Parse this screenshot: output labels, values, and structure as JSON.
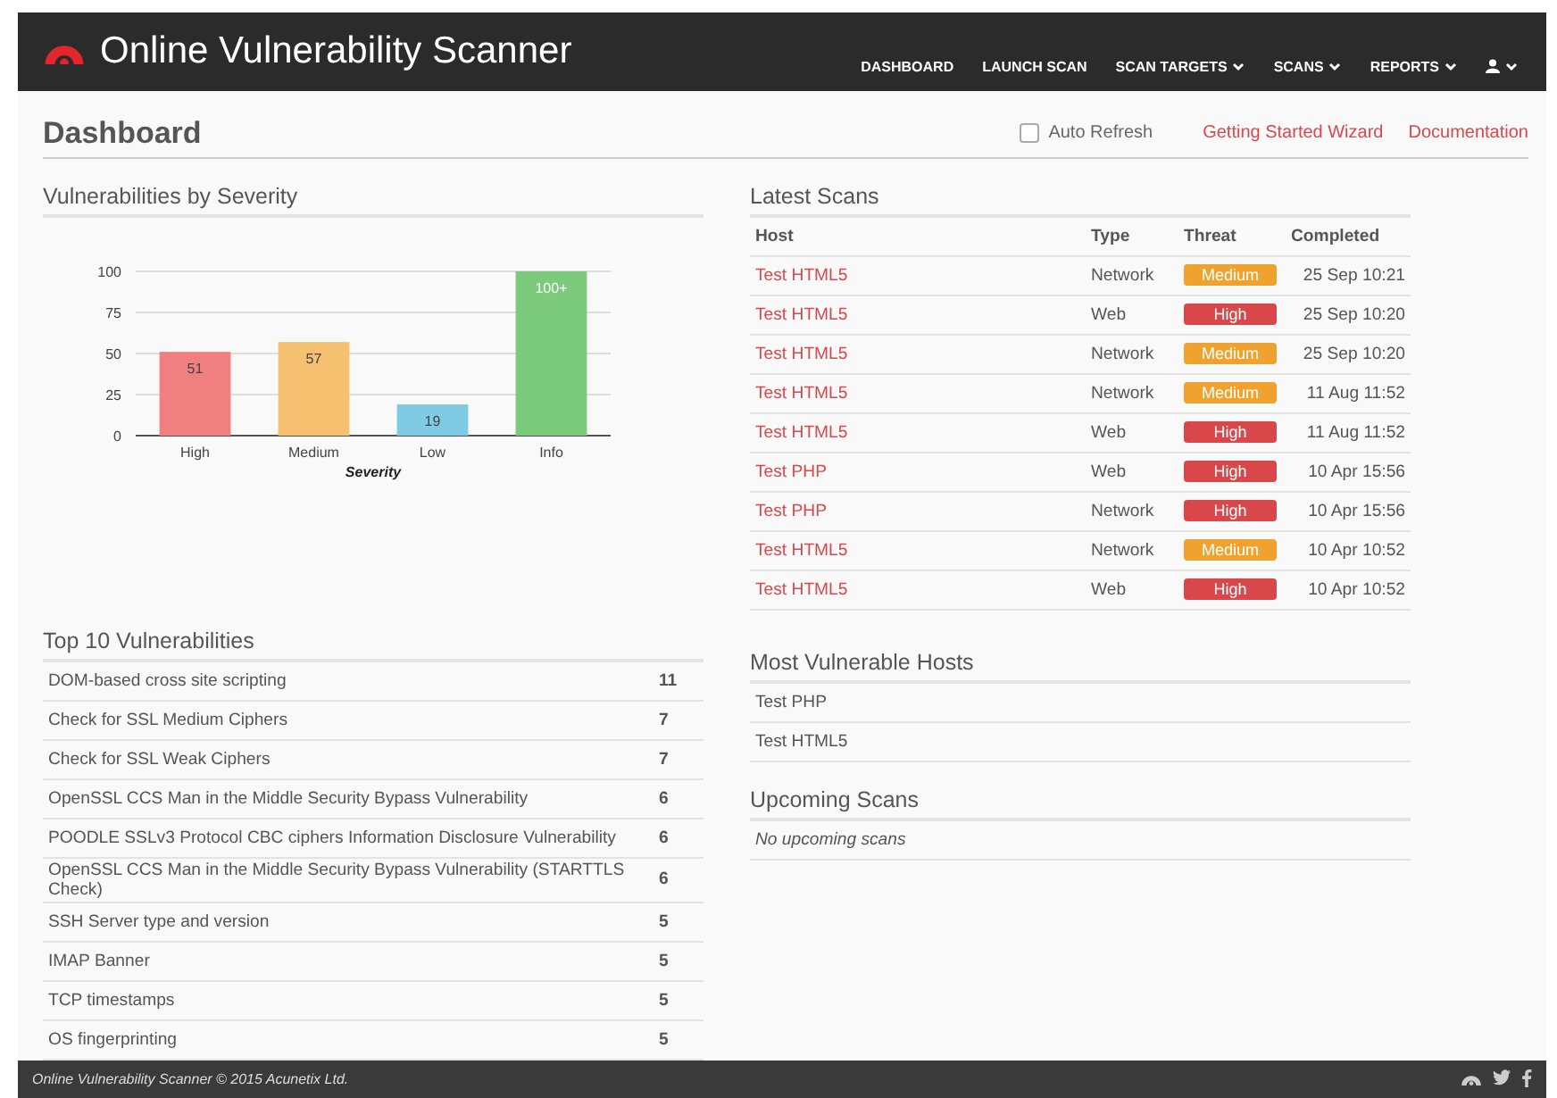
{
  "header": {
    "brand": "Online Vulnerability Scanner",
    "nav": [
      {
        "label": "DASHBOARD",
        "has_menu": false
      },
      {
        "label": "LAUNCH SCAN",
        "has_menu": false
      },
      {
        "label": "SCAN TARGETS",
        "has_menu": true
      },
      {
        "label": "SCANS",
        "has_menu": true
      },
      {
        "label": "REPORTS",
        "has_menu": true
      },
      {
        "kind": "user",
        "has_menu": true
      }
    ]
  },
  "page": {
    "title": "Dashboard",
    "auto_refresh": {
      "label": "Auto Refresh",
      "checked": false
    },
    "links": [
      "Getting Started Wizard",
      "Documentation"
    ]
  },
  "severity_panel": {
    "title": "Vulnerabilities by Severity",
    "chart_data": {
      "type": "bar",
      "xlabel": "Severity",
      "categories": [
        "High",
        "Medium",
        "Low",
        "Info"
      ],
      "values": [
        51,
        57,
        19,
        100
      ],
      "grid": true,
      "colors": [
        "#f08080",
        "#f5c06f",
        "#7ecbe3",
        "#7ccb7c"
      ],
      "value_labels": [
        "51",
        "57",
        "19",
        "100+"
      ],
      "ylim": [
        0,
        100
      ],
      "yticks": [
        0,
        25,
        50,
        75,
        100
      ]
    }
  },
  "latest_scans": {
    "title": "Latest Scans",
    "columns": [
      "Host",
      "Type",
      "Threat",
      "Completed"
    ],
    "rows": [
      {
        "host": "Test HTML5",
        "type": "Network",
        "threat": "Medium",
        "color": "#f0a22e",
        "completed": "25 Sep 10:21"
      },
      {
        "host": "Test HTML5",
        "type": "Web",
        "threat": "High",
        "color": "#d9474a",
        "completed": "25 Sep 10:20"
      },
      {
        "host": "Test HTML5",
        "type": "Network",
        "threat": "Medium",
        "color": "#f0a22e",
        "completed": "25 Sep 10:20"
      },
      {
        "host": "Test HTML5",
        "type": "Network",
        "threat": "Medium",
        "color": "#f0a22e",
        "completed": "11 Aug 11:52"
      },
      {
        "host": "Test HTML5",
        "type": "Web",
        "threat": "High",
        "color": "#d9474a",
        "completed": "11 Aug 11:52"
      },
      {
        "host": "Test PHP",
        "type": "Web",
        "threat": "High",
        "color": "#d9474a",
        "completed": "10 Apr 15:56"
      },
      {
        "host": "Test PHP",
        "type": "Network",
        "threat": "High",
        "color": "#d9474a",
        "completed": "10 Apr 15:56"
      },
      {
        "host": "Test HTML5",
        "type": "Network",
        "threat": "Medium",
        "color": "#f0a22e",
        "completed": "10 Apr 10:52"
      },
      {
        "host": "Test HTML5",
        "type": "Web",
        "threat": "High",
        "color": "#d9474a",
        "completed": "10 Apr 10:52"
      }
    ]
  },
  "top_vulnerabilities": {
    "title": "Top 10 Vulnerabilities",
    "rows": [
      {
        "name": "DOM-based cross site scripting",
        "count": "11"
      },
      {
        "name": "Check for SSL Medium Ciphers",
        "count": "7"
      },
      {
        "name": "Check for SSL Weak Ciphers",
        "count": "7"
      },
      {
        "name": "OpenSSL CCS Man in the Middle Security Bypass Vulnerability",
        "count": "6"
      },
      {
        "name": "POODLE SSLv3 Protocol CBC ciphers Information Disclosure Vulnerability",
        "count": "6"
      },
      {
        "name": "OpenSSL CCS Man in the Middle Security Bypass Vulnerability (STARTTLS Check)",
        "count": "6"
      },
      {
        "name": "SSH Server type and version",
        "count": "5"
      },
      {
        "name": "IMAP Banner",
        "count": "5"
      },
      {
        "name": "TCP timestamps",
        "count": "5"
      },
      {
        "name": "OS fingerprinting",
        "count": "5"
      }
    ]
  },
  "most_vulnerable_hosts": {
    "title": "Most Vulnerable Hosts",
    "rows": [
      "Test PHP",
      "Test HTML5"
    ]
  },
  "upcoming_scans": {
    "title": "Upcoming Scans",
    "empty_text": "No upcoming scans"
  },
  "footer": {
    "text": "Online Vulnerability Scanner © 2015 Acunetix Ltd."
  }
}
